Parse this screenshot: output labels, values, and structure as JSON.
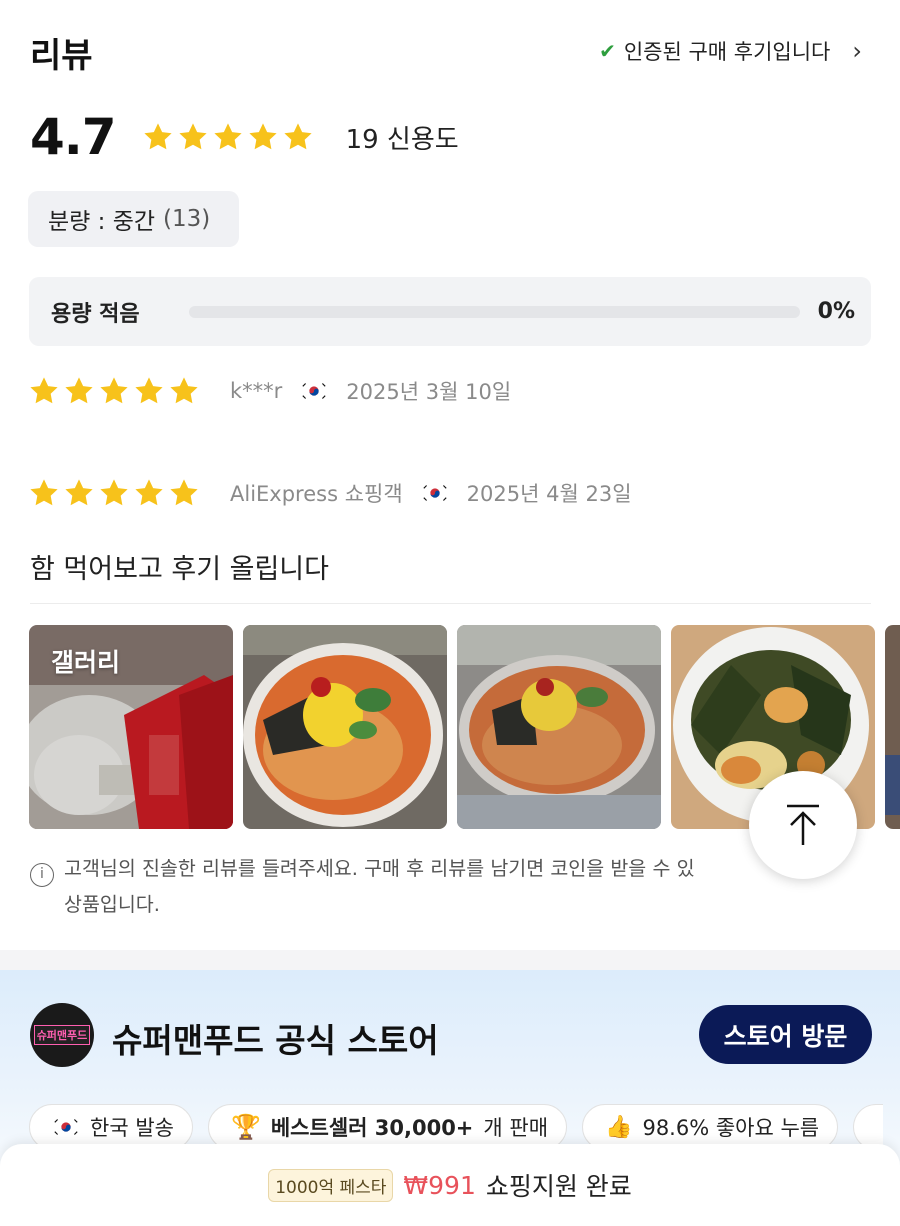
{
  "header": {
    "title": "리뷰",
    "verified_text": "인증된 구매 후기입니다"
  },
  "rating": {
    "score": "4.7",
    "stars": 5,
    "count_text": "19 신용도"
  },
  "filter_chip": {
    "label": "분량 : 중간",
    "count": "(13)"
  },
  "capacity_bar": {
    "label": "용량 적음",
    "percent_text": "0%",
    "percent": 0
  },
  "reviews": [
    {
      "stars": 5,
      "author": "k***r",
      "country": "KR",
      "date": "2025년 3월 10일",
      "text": ""
    },
    {
      "stars": 5,
      "author": "AliExpress 쇼핑객",
      "country": "KR",
      "date": "2025년 4월 23일",
      "text": "함 먹어보고 후기 올립니다"
    }
  ],
  "gallery": {
    "label": "갤러리"
  },
  "notice": {
    "line1": "고객님의 진솔한 리뷰를 들려주세요. 구매 후 리뷰를 남기면 코인을 받을 수 있",
    "line2": "상품입니다."
  },
  "store": {
    "logo_text": "슈퍼맨푸드",
    "name": "슈퍼맨푸드 공식 스토어",
    "visit_label": "스토어 방문",
    "badges": {
      "shipping": "한국 발송",
      "bestseller_bold": "베스트셀러 30,000+",
      "bestseller_rest": "개 판매",
      "likes": "98.6% 좋아요 누름"
    }
  },
  "bottom_bar": {
    "festa_label": "1000억 페스타",
    "price": "₩991",
    "status": "쇼핑지원 완료"
  },
  "colors": {
    "star": "#f7c21b",
    "verified_check": "#2e9e3e",
    "visit_button": "#0b1a57",
    "price": "#e8525b"
  }
}
